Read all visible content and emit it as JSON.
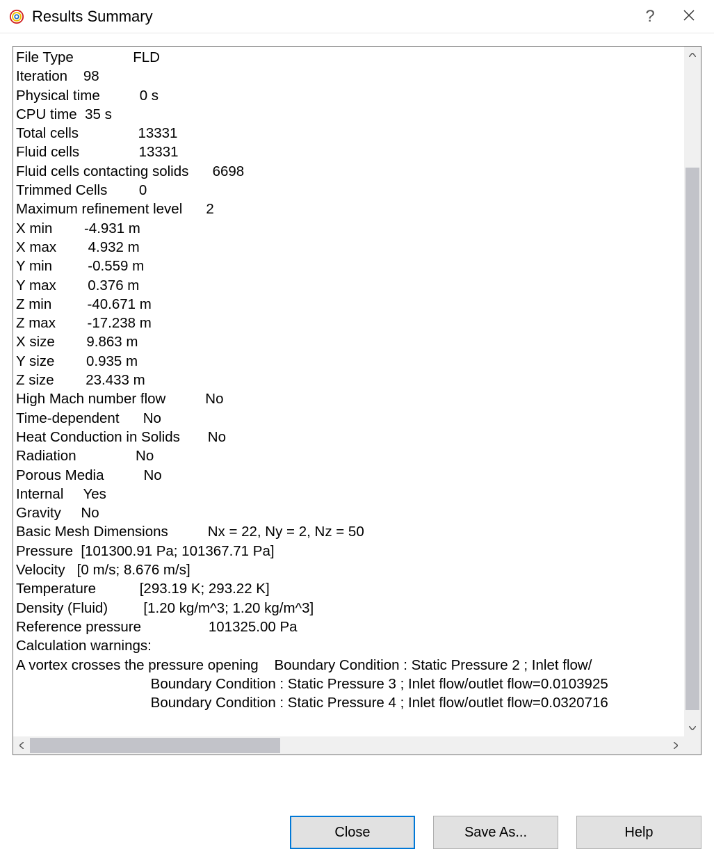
{
  "window": {
    "title": "Results Summary"
  },
  "summary": {
    "lines": [
      "File Type               FLD",
      "Iteration    98",
      "Physical time          0 s",
      "CPU time  35 s",
      "Total cells               13331",
      "Fluid cells               13331",
      "Fluid cells contacting solids      6698",
      "Trimmed Cells        0",
      "Maximum refinement level      2",
      "X min        -4.931 m",
      "X max        4.932 m",
      "Y min         -0.559 m",
      "Y max        0.376 m",
      "Z min         -40.671 m",
      "Z max        -17.238 m",
      "X size        9.863 m",
      "Y size        0.935 m",
      "Z size        23.433 m",
      "High Mach number flow          No",
      "Time-dependent      No",
      "Heat Conduction in Solids       No",
      "Radiation               No",
      "Porous Media          No",
      "Internal     Yes",
      "Gravity     No",
      "Basic Mesh Dimensions          Nx = 22, Ny = 2, Nz = 50",
      "Pressure  [101300.91 Pa; 101367.71 Pa]",
      "Velocity   [0 m/s; 8.676 m/s]",
      "Temperature           [293.19 K; 293.22 K]",
      "Density (Fluid)         [1.20 kg/m^3; 1.20 kg/m^3]",
      "Reference pressure                 101325.00 Pa",
      "Calculation warnings:",
      "A vortex crosses the pressure opening    Boundary Condition : Static Pressure 2 ; Inlet flow/",
      "                                  Boundary Condition : Static Pressure 3 ; Inlet flow/outlet flow=0.0103925",
      "                                  Boundary Condition : Static Pressure 4 ; Inlet flow/outlet flow=0.0320716"
    ]
  },
  "buttons": {
    "close": "Close",
    "save_as": "Save As...",
    "help": "Help"
  }
}
